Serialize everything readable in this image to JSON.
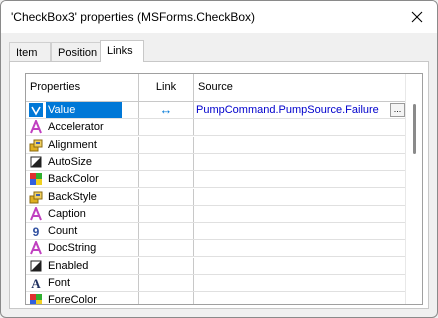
{
  "window": {
    "title": "'CheckBox3' properties (MSForms.CheckBox)"
  },
  "tabs": [
    {
      "label": "Item",
      "active": false
    },
    {
      "label": "Position",
      "active": false
    },
    {
      "label": "Links",
      "active": true
    }
  ],
  "grid": {
    "headers": {
      "properties": "Properties",
      "link": "Link",
      "source": "Source"
    },
    "rows": [
      {
        "icon": "boolean-icon",
        "name": "Value",
        "link": "↔",
        "source": "PumpCommand.PumpSource.Failure",
        "selected": true
      },
      {
        "icon": "text-icon",
        "name": "Accelerator",
        "link": "",
        "source": "",
        "selected": false
      },
      {
        "icon": "enum-icon",
        "name": "Alignment",
        "link": "",
        "source": "",
        "selected": false
      },
      {
        "icon": "bool-square-icon",
        "name": "AutoSize",
        "link": "",
        "source": "",
        "selected": false
      },
      {
        "icon": "color-icon",
        "name": "BackColor",
        "link": "",
        "source": "",
        "selected": false
      },
      {
        "icon": "enum-icon",
        "name": "BackStyle",
        "link": "",
        "source": "",
        "selected": false
      },
      {
        "icon": "text-icon",
        "name": "Caption",
        "link": "",
        "source": "",
        "selected": false
      },
      {
        "icon": "number-icon",
        "name": "Count",
        "link": "",
        "source": "",
        "selected": false
      },
      {
        "icon": "text-icon",
        "name": "DocString",
        "link": "",
        "source": "",
        "selected": false
      },
      {
        "icon": "bool-square-icon",
        "name": "Enabled",
        "link": "",
        "source": "",
        "selected": false
      },
      {
        "icon": "font-icon",
        "name": "Font",
        "link": "",
        "source": "",
        "selected": false
      },
      {
        "icon": "color-icon",
        "name": "ForeColor",
        "link": "",
        "source": "",
        "selected": false
      }
    ],
    "ellipsis_label": "...",
    "scroll_position": 0
  },
  "colors": {
    "selection": "#0078d7",
    "source_link": "#0000cc",
    "text_icon": "#c040c0",
    "boolean_icon": "#ffffff",
    "number_icon": "#3050a0"
  }
}
